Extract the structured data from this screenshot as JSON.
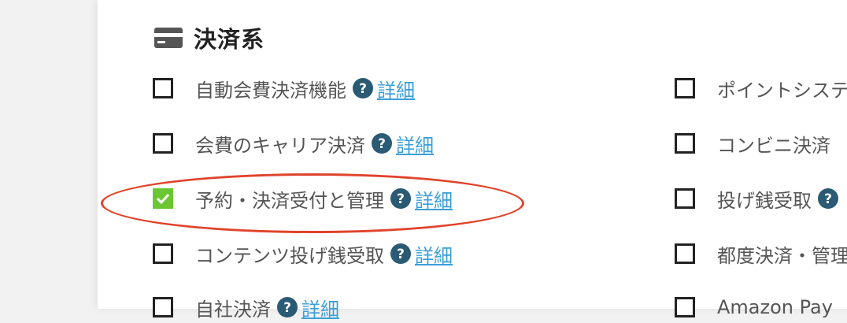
{
  "section": {
    "title": "決済系",
    "icon": "credit-card-icon"
  },
  "detail_label": "詳細",
  "left_column": [
    {
      "label": "自動会費決済機能",
      "checked": false,
      "help": true,
      "detail": true
    },
    {
      "label": "会費のキャリア決済",
      "checked": false,
      "help": true,
      "detail": true
    },
    {
      "label": "予約・決済受付と管理",
      "checked": true,
      "help": true,
      "detail": true
    },
    {
      "label": "コンテンツ投げ銭受取",
      "checked": false,
      "help": true,
      "detail": true
    },
    {
      "label": "自社決済",
      "checked": false,
      "help": true,
      "detail": true
    }
  ],
  "right_column": [
    {
      "label": "ポイントシステ",
      "checked": false
    },
    {
      "label": "コンビニ決済",
      "checked": false
    },
    {
      "label": "投げ銭受取",
      "checked": false,
      "help": true
    },
    {
      "label": "都度決済・管理",
      "checked": false
    },
    {
      "label": "Amazon Pay",
      "checked": false
    }
  ],
  "colors": {
    "checked": "#6ac733",
    "link": "#3a9fd9",
    "help": "#2a5a74",
    "annotation": "#e0432b"
  }
}
